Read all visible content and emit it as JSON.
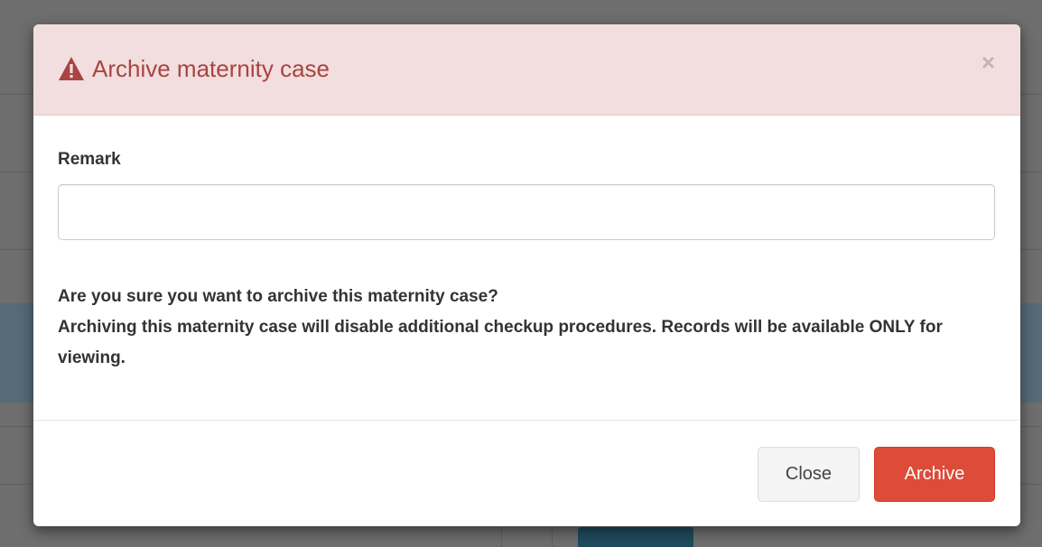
{
  "modal": {
    "title": "Archive maternity case",
    "close_symbol": "×",
    "header_icon": "warning-icon",
    "header_bg": "#f2dede",
    "title_color": "#a94442"
  },
  "form": {
    "remark_label": "Remark",
    "remark_value": "",
    "remark_placeholder": ""
  },
  "message": {
    "question": "Are you sure you want to archive this maternity case?",
    "detail": "Archiving this maternity case will disable additional checkup procedures. Records will be available ONLY for viewing."
  },
  "footer": {
    "close_label": "Close",
    "archive_label": "Archive",
    "archive_color": "#dd4b39"
  }
}
